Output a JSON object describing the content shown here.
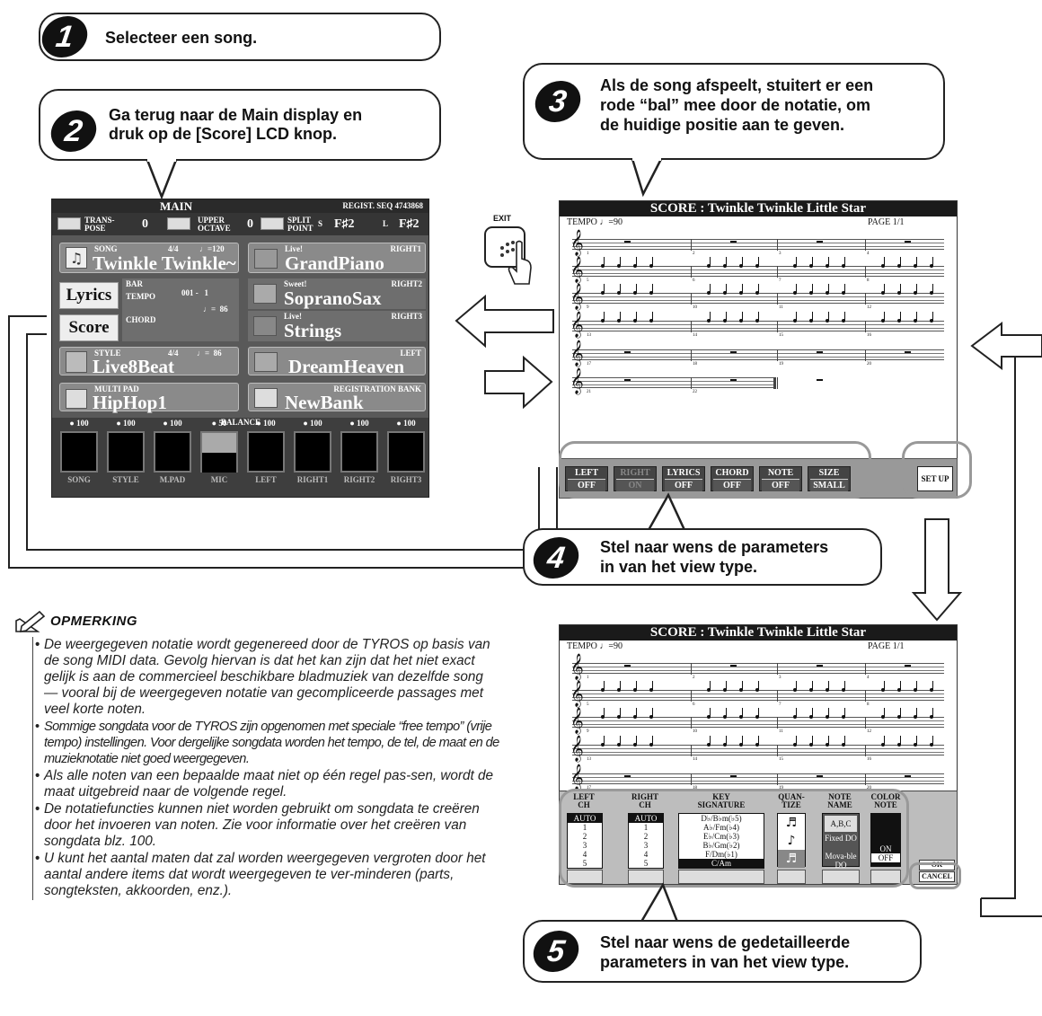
{
  "steps": [
    {
      "num": "1",
      "text": "Selecteer een song."
    },
    {
      "num": "2",
      "text_l1": "Ga terug naar de Main display en",
      "text_l2": "druk op de [Score] LCD knop."
    },
    {
      "num": "3",
      "text_l1": "Als de song afspeelt, stuitert er een",
      "text_l2": "rode “bal” mee door de notatie, om",
      "text_l3": "de huidige positie aan te geven."
    },
    {
      "num": "4",
      "text_l1": "Stel naar wens de parameters",
      "text_l2": "in van het view type."
    },
    {
      "num": "5",
      "text_l1": "Stel naar wens de gedetailleerde",
      "text_l2": "parameters in van het view type."
    }
  ],
  "main": {
    "title": "MAIN",
    "regist": "REGIST. SEQ 4743868",
    "transpose_label": "TRANS-\nPOSE",
    "transpose_val": "0",
    "upper_octave_label": "UPPER\nOCTAVE",
    "upper_octave_val": "0",
    "split_label": "SPLIT\nPOINT",
    "split_s": "S",
    "split_s_val": "F♯2",
    "split_l": "L",
    "split_l_val": "F♯2",
    "song_label": "SONG",
    "song_meter": "4/4",
    "song_tempo": "♩=120",
    "song_name": "Twinkle Twinkle~",
    "lyrics_button": "Lyrics",
    "score_button": "Score",
    "bar_label": "BAR",
    "bar_val": "001 -   1",
    "tempo_label": "TEMPO",
    "tempo_val": "♩=  86",
    "chord_label": "CHORD",
    "style_label": "STYLE",
    "style_meter": "4/4",
    "style_tempo": "♩=  86",
    "style_name": "Live8Beat",
    "multipad_label": "MULTI PAD",
    "multipad_name": "HipHop1",
    "right1_tag": "Live!",
    "right1_label": "RIGHT1",
    "right1_voice": "GrandPiano",
    "right2_tag": "Sweet!",
    "right2_label": "RIGHT2",
    "right2_voice": "SopranoSax",
    "right3_tag": "Live!",
    "right3_label": "RIGHT3",
    "right3_voice": "Strings",
    "left_label": "LEFT",
    "left_voice": "DreamHeaven",
    "regbank_label": "REGISTRATION BANK",
    "regbank_name": "NewBank",
    "balance_label": "BALANCE",
    "mixer": [
      {
        "name": "SONG",
        "value": "100"
      },
      {
        "name": "STYLE",
        "value": "100"
      },
      {
        "name": "M.PAD",
        "value": "100"
      },
      {
        "name": "MIC",
        "value": "50"
      },
      {
        "name": "LEFT",
        "value": "100"
      },
      {
        "name": "RIGHT1",
        "value": "100"
      },
      {
        "name": "RIGHT2",
        "value": "100"
      },
      {
        "name": "RIGHT3",
        "value": "100"
      }
    ]
  },
  "exit_label": "EXIT",
  "score_top": {
    "title": "SCORE : Twinkle Twinkle Little Star",
    "tempo": "TEMPO ♩=90",
    "page": "PAGE 1/1",
    "buttons": [
      {
        "label": "LEFT",
        "value": "OFF"
      },
      {
        "label": "RIGHT",
        "value": "ON"
      },
      {
        "label": "LYRICS",
        "value": "OFF"
      },
      {
        "label": "CHORD",
        "value": "OFF"
      },
      {
        "label": "NOTE",
        "value": "OFF"
      },
      {
        "label": "SIZE",
        "value": "SMALL"
      }
    ],
    "setup": "SET UP",
    "measures": [
      "1",
      "2",
      "3",
      "4",
      "5",
      "6",
      "7",
      "8",
      "9",
      "10",
      "11",
      "12",
      "13",
      "14",
      "15",
      "16",
      "17",
      "18",
      "19",
      "20",
      "21",
      "22"
    ]
  },
  "score_bottom": {
    "title": "SCORE : Twinkle Twinkle Little Star",
    "tempo": "TEMPO ♩=90",
    "page": "PAGE 1/1",
    "left_ch": {
      "h1": "LEFT",
      "h2": "CH",
      "items": [
        "AUTO",
        "1",
        "2",
        "3",
        "4",
        "5"
      ]
    },
    "right_ch": {
      "h1": "RIGHT",
      "h2": "CH",
      "items": [
        "AUTO",
        "1",
        "2",
        "3",
        "4",
        "5"
      ]
    },
    "key_sig": {
      "h1": "KEY",
      "h2": "SIGNATURE",
      "items": [
        "D♭/B♭m(♭5)",
        "A♭/Fm(♭4)",
        "E♭/Cm(♭3)",
        "B♭/Gm(♭2)",
        "F/Dm(♭1)",
        "C/Am"
      ]
    },
    "quantize": {
      "h1": "QUAN-",
      "h2": "TIZE"
    },
    "note_name": {
      "h1": "NOTE",
      "h2": "NAME",
      "items": [
        "A,B,C",
        "Fixed DO",
        "Mova-ble DO"
      ]
    },
    "color_note": {
      "h1": "COLOR",
      "h2": "NOTE",
      "items": [
        "ON",
        "OFF"
      ]
    },
    "ok": "OK",
    "cancel": "CANCEL"
  },
  "opmerking": {
    "title": "OPMERKING",
    "bullets": [
      "De weergegeven notatie wordt gegenereed door de TYROS op basis van de song MIDI data. Gevolg hiervan is dat het kan zijn dat het niet exact gelijk is aan de commercieel beschikbare bladmuziek van dezelfde song — vooral bij de weergegeven notatie van gecompliceerde passages met veel korte noten.",
      "Sommige songdata voor de TYROS zijn opgenomen met speciale “free tempo” (vrije tempo) instellingen. Voor dergelijke songdata worden het tempo, de tel, de maat en de muzieknotatie niet goed weergegeven.",
      "Als alle noten van een bepaalde maat niet op één regel pas-sen, wordt de maat uitgebreid naar de volgende regel.",
      "De notatiefuncties kunnen niet worden gebruikt om songdata te creëren door het invoeren van noten. Zie voor informatie over het creëren van songdata blz. 100.",
      "U kunt het aantal maten dat zal worden weergegeven vergroten door het aantal andere items dat wordt weergegeven te ver-minderen (parts, songteksten, akkoorden, enz.)."
    ]
  }
}
